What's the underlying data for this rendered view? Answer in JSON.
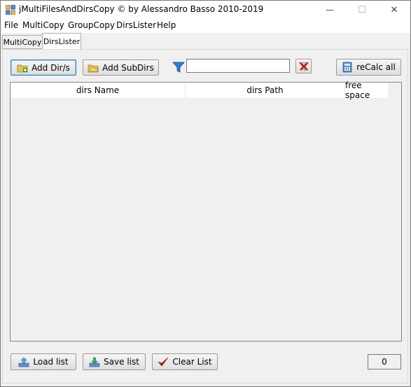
{
  "window": {
    "title": "jMultiFilesAndDirsCopy  © by Alessandro Basso 2010-2019",
    "minimize": "—",
    "maximize": "☐",
    "close": "✕"
  },
  "menu": [
    "File",
    "MultiCopy",
    "GroupCopy",
    "DirsLister",
    "Help"
  ],
  "tabs": [
    {
      "label": "MultiCopy",
      "active": false
    },
    {
      "label": "DirsLister",
      "active": true
    }
  ],
  "toolbar": {
    "add_dirs": "Add Dir/s",
    "add_subdirs": "Add SubDirs",
    "filter_value": "",
    "recalc": "reCalc all"
  },
  "table": {
    "columns": [
      "dirs  Name",
      "dirs  Path",
      "free space"
    ],
    "rows": []
  },
  "footer": {
    "load": "Load list",
    "save": "Save list",
    "clear": "Clear List",
    "count": "0"
  },
  "colors": {
    "accent_border": "#3c7fb1",
    "clear_red": "#cc1111",
    "filter_blue": "#2a7fd6"
  }
}
